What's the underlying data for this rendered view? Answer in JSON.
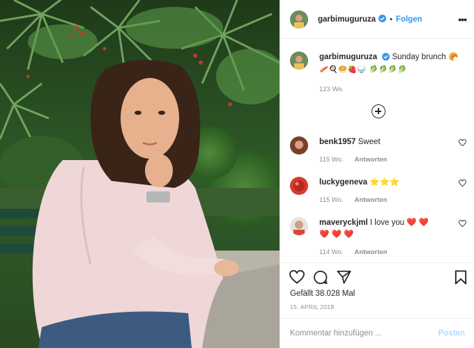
{
  "post": {
    "photo_alt": "photo-post-image",
    "author": {
      "username": "garbimuguruza",
      "verified": true,
      "separator": "•",
      "follow_label": "Folgen",
      "more_label": "•••"
    },
    "caption": {
      "username": "garbimuguruza",
      "text": "Sunday brunch 🥐",
      "emoji_line": "🥓🍳🥯🍓🍚 🥬🥬🥬🥬",
      "time": "123 Wo."
    },
    "comments": [
      {
        "username": "benk1957",
        "text": "Sweet",
        "time": "115 Wo.",
        "reply_label": "Antworten",
        "avatar_color": "#7a3e2a"
      },
      {
        "username": "luckygeneva",
        "text": "⭐⭐⭐",
        "time": "115 Wo.",
        "reply_label": "Antworten",
        "avatar_color": "#d63b2f"
      },
      {
        "username": "maveryckjml",
        "text": "I love you ❤️ ❤️",
        "text_line2": "❤️ ❤️ ❤️",
        "time": "114 Wo.",
        "reply_label": "Antworten",
        "avatar_color": "#c9a08c"
      }
    ],
    "likes_text": "Gefällt 38.028 Mal",
    "date": "15. APRIL 2018",
    "comment_input": {
      "placeholder": "Kommentar hinzufügen ...",
      "value": ""
    },
    "post_label": "Posten",
    "colors": {
      "accent": "#3897f0",
      "post_disabled": "#b3dbff",
      "muted": "#8e8e8e",
      "text": "#262626"
    }
  }
}
